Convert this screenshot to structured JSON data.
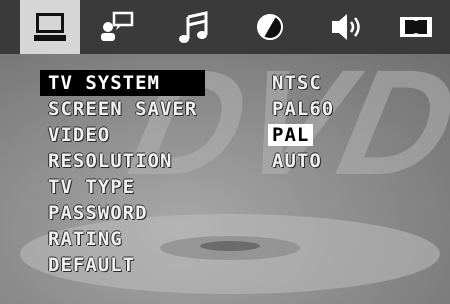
{
  "tabs": [
    {
      "icon": "monitor-icon",
      "active": true
    },
    {
      "icon": "person-speech-icon",
      "active": false
    },
    {
      "icon": "music-note-icon",
      "active": false
    },
    {
      "icon": "color-circle-icon",
      "active": false
    },
    {
      "icon": "speaker-icon",
      "active": false
    },
    {
      "icon": "dolby-icon",
      "active": false
    }
  ],
  "menu": {
    "items": [
      {
        "label": "TV SYSTEM",
        "selected": true
      },
      {
        "label": "SCREEN SAVER",
        "selected": false
      },
      {
        "label": "VIDEO",
        "selected": false
      },
      {
        "label": "RESOLUTION",
        "selected": false
      },
      {
        "label": "TV TYPE",
        "selected": false
      },
      {
        "label": "PASSWORD",
        "selected": false
      },
      {
        "label": "RATING",
        "selected": false
      },
      {
        "label": "DEFAULT",
        "selected": false
      }
    ]
  },
  "options": {
    "items": [
      {
        "label": "NTSC",
        "selected": false
      },
      {
        "label": "PAL60",
        "selected": false
      },
      {
        "label": "PAL",
        "selected": true
      },
      {
        "label": "AUTO",
        "selected": false
      }
    ]
  },
  "colors": {
    "topbar": "#3a3a3a",
    "active_tab": "#d6d6d6",
    "menu_highlight": "#000000",
    "option_highlight": "#ffffff"
  }
}
